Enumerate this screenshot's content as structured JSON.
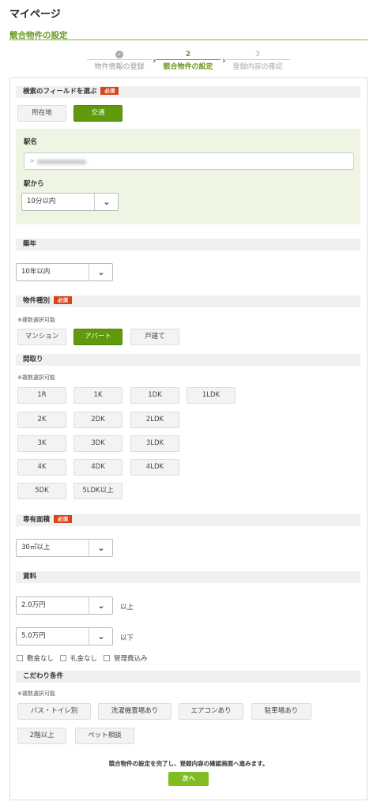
{
  "page": {
    "title": "マイページ",
    "subtitle": "競合物件の設定"
  },
  "steps": [
    {
      "num": "",
      "label": "物件情報の登録",
      "state": "done"
    },
    {
      "num": "2",
      "label": "競合物件の設定",
      "state": "active"
    },
    {
      "num": "3",
      "label": "登録内容の確認",
      "state": "todo"
    }
  ],
  "required_badge": "必須",
  "multi_note": "※複数選択可能",
  "search_field": {
    "heading": "検索のフィールドを選ぶ",
    "options": [
      "所在地",
      "交通"
    ],
    "selected": "交通",
    "station_label": "駅名",
    "station_prefix": ">",
    "from_station_label": "駅から",
    "from_station_value": "10分以内"
  },
  "age": {
    "heading": "築年",
    "value": "10年以内"
  },
  "property_type": {
    "heading": "物件種別",
    "options": [
      "マンション",
      "アパート",
      "戸建て"
    ],
    "selected": "アパート"
  },
  "layout": {
    "heading": "間取り",
    "rows": [
      [
        "1R",
        "1K",
        "1DK",
        "1LDK"
      ],
      [
        "2K",
        "2DK",
        "2LDK"
      ],
      [
        "3K",
        "3DK",
        "3LDK"
      ],
      [
        "4K",
        "4DK",
        "4LDK"
      ],
      [
        "5DK",
        "5LDK以上"
      ]
    ]
  },
  "area": {
    "heading": "専有面積",
    "value": "30㎡以上"
  },
  "rent": {
    "heading": "賃料",
    "min_value": "2.0万円",
    "min_suffix": "以上",
    "max_value": "5.0万円",
    "max_suffix": "以下",
    "checks": [
      "敷金なし",
      "礼金なし",
      "管理費込み"
    ]
  },
  "preferences": {
    "heading": "こだわり条件",
    "row1": [
      "バス・トイレ別",
      "洗濯機置場あり",
      "エアコンあり",
      "駐車場あり"
    ],
    "row2": [
      "2階以上",
      "ペット相談"
    ]
  },
  "footer": {
    "message": "競合物件の設定を完了し、登録内容の確認画面へ進みます。",
    "next_label": "次へ"
  },
  "colors": {
    "accent": "#5e9a0b",
    "required": "#d9441a",
    "panel_bg": "#eef5e2"
  }
}
